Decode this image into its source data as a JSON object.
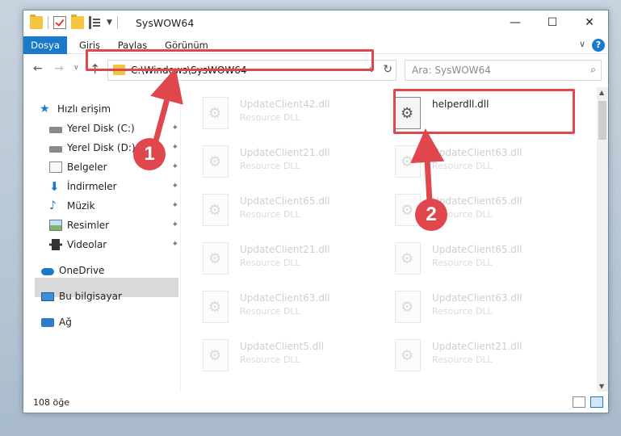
{
  "window": {
    "title": "SysWOW64",
    "min_glyph": "—",
    "max_glyph": "☐",
    "close_glyph": "✕"
  },
  "ribbon": {
    "tabs": [
      "Dosya",
      "Giriş",
      "Paylaş",
      "Görünüm"
    ],
    "expand_glyph": "∨",
    "help_glyph": "?"
  },
  "address": {
    "path": "C:\\Windows\\SysWOW64",
    "search_placeholder": "Ara: SysWOW64"
  },
  "sidebar": {
    "items": [
      {
        "label": "Hızlı erişim",
        "icon": "star-icon"
      },
      {
        "label": "Yerel Disk (C:)",
        "icon": "drive-icon",
        "pinned": true
      },
      {
        "label": "Yerel Disk (D:)",
        "icon": "drive-icon",
        "pinned": true
      },
      {
        "label": "Belgeler",
        "icon": "document-icon",
        "pinned": true
      },
      {
        "label": "İndirmeler",
        "icon": "download-icon",
        "pinned": true
      },
      {
        "label": "Müzik",
        "icon": "music-icon",
        "pinned": true
      },
      {
        "label": "Resimler",
        "icon": "pictures-icon",
        "pinned": true
      },
      {
        "label": "Videolar",
        "icon": "video-icon",
        "pinned": true
      },
      {
        "label": "OneDrive",
        "icon": "cloud-icon"
      },
      {
        "label": "Bu bilgisayar",
        "icon": "computer-icon",
        "selected": true
      },
      {
        "label": "Ağ",
        "icon": "network-icon"
      }
    ]
  },
  "files": [
    {
      "name": "UpdateClient42.dll",
      "type": "Resource DLL"
    },
    {
      "name": "helperdll.dll",
      "type": "",
      "highlighted": true
    },
    {
      "name": "UpdateClient21.dll",
      "type": "Resource DLL"
    },
    {
      "name": "UpdateClient63.dll",
      "type": "Resource DLL"
    },
    {
      "name": "UpdateClient65.dll",
      "type": "Resource DLL"
    },
    {
      "name": "UpdateClient65.dll",
      "type": "Resource DLL"
    },
    {
      "name": "UpdateClient21.dll",
      "type": "Resource DLL"
    },
    {
      "name": "UpdateClient65.dll",
      "type": "Resource DLL"
    },
    {
      "name": "UpdateClient63.dll",
      "type": "Resource DLL"
    },
    {
      "name": "UpdateClient63.dll",
      "type": "Resource DLL"
    },
    {
      "name": "UpdateClient5.dll",
      "type": "Resource DLL"
    },
    {
      "name": "UpdateClient21.dll",
      "type": "Resource DLL"
    }
  ],
  "status": {
    "item_count": "108 öğe"
  },
  "annotations": {
    "step1": "1",
    "step2": "2",
    "color": "#e0474c"
  },
  "colors": {
    "accent": "#1979ca",
    "highlight_red": "#e0474c",
    "folder_yellow": "#f5c542"
  }
}
